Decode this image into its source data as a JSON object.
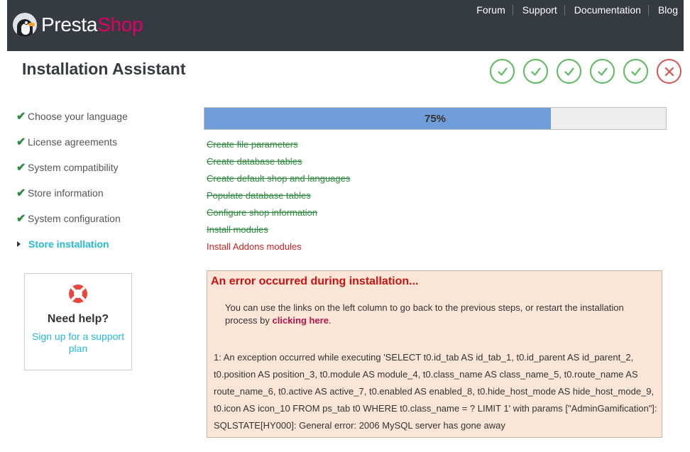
{
  "brand": {
    "part1": "Presta",
    "part2": "Shop"
  },
  "topnav": [
    "Forum",
    "Support",
    "Documentation",
    "Blog"
  ],
  "page_title": "Installation Assistant",
  "step_states": [
    "done",
    "done",
    "done",
    "done",
    "done",
    "error"
  ],
  "sidebar": {
    "items": [
      {
        "label": "Choose your language",
        "state": "done"
      },
      {
        "label": "License agreements",
        "state": "done"
      },
      {
        "label": "System compatibility",
        "state": "done"
      },
      {
        "label": "Store information",
        "state": "done"
      },
      {
        "label": "System configuration",
        "state": "done"
      },
      {
        "label": "Store installation",
        "state": "current"
      }
    ],
    "done_mark": "✔"
  },
  "help": {
    "title": "Need help?",
    "link": "Sign up for a support plan"
  },
  "progress": {
    "value": 0.75,
    "label": "75%"
  },
  "tasks": [
    {
      "label": "Create file parameters",
      "state": "done"
    },
    {
      "label": "Create database tables",
      "state": "done"
    },
    {
      "label": "Create default shop and languages",
      "state": "done"
    },
    {
      "label": "Populate database tables",
      "state": "done"
    },
    {
      "label": "Configure shop information",
      "state": "done"
    },
    {
      "label": "Install modules",
      "state": "done"
    },
    {
      "label": "Install Addons modules",
      "state": "failed"
    }
  ],
  "error": {
    "title": "An error occurred during installation...",
    "message_prefix": "You can use the links on the left column to go back to the previous steps, or restart the installation process by ",
    "message_link": "clicking here",
    "message_suffix": ".",
    "detail": "1: An exception occurred while executing 'SELECT t0.id_tab AS id_tab_1, t0.id_parent AS id_parent_2, t0.position AS position_3, t0.module AS module_4, t0.class_name AS class_name_5, t0.route_name AS route_name_6, t0.active AS active_7, t0.enabled AS enabled_8, t0.hide_host_mode AS hide_host_mode_9, t0.icon AS icon_10 FROM ps_tab t0 WHERE t0.class_name = ? LIMIT 1' with params [\"AdminGamification\"]: SQLSTATE[HY000]: General error: 2006 MySQL server has gone away"
  },
  "colors": {
    "header": "#363a41",
    "accent": "#25b9d7",
    "brand_pink": "#df0067",
    "success": "#5cb85c",
    "danger": "#d9534f",
    "progress": "#6f9ed9"
  }
}
